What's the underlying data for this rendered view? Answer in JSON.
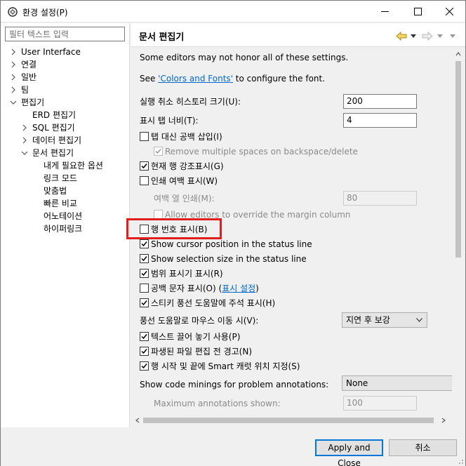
{
  "window": {
    "title": "환경 설정(P)"
  },
  "filter": {
    "placeholder": "필터 텍스트 입력"
  },
  "tree": [
    {
      "label": "User Interface"
    },
    {
      "label": "연결"
    },
    {
      "label": "일반"
    },
    {
      "label": "팀"
    },
    {
      "label": "편집기"
    },
    {
      "label": "ERD 편집기"
    },
    {
      "label": "SQL 편집기"
    },
    {
      "label": "데이터 편집기"
    },
    {
      "label": "문서 편집기"
    },
    {
      "label": "내게 필요한 옵션"
    },
    {
      "label": "링크 모드"
    },
    {
      "label": "맞춤법"
    },
    {
      "label": "빠른 비교"
    },
    {
      "label": "어노테이션"
    },
    {
      "label": "하이퍼링크"
    }
  ],
  "page": {
    "title": "문서 편집기",
    "note": "Some editors may not honor all of these settings.",
    "font_prefix": "See ",
    "font_link": "'Colors and Fonts'",
    "font_suffix": " to configure the font.",
    "undo_label": "실행 취소 히스토리 크기(U):",
    "undo_value": "200",
    "tab_label": "표시 탭 너비(T):",
    "tab_value": "4",
    "spaces_for_tabs": {
      "label": "탭 대신 공백 삽입(I)",
      "checked": false
    },
    "remove_multiple": {
      "label": "Remove multiple spaces on backspace/delete",
      "checked": true,
      "disabled": true
    },
    "highlight_line": {
      "label": "현재 행 강조표시(G)",
      "checked": true
    },
    "print_margin": {
      "label": "인쇄 여백 표시(W)",
      "checked": false
    },
    "margin_col_label": "여백 열 인쇄(M):",
    "margin_col_value": "80",
    "allow_override": {
      "label": "Allow editors to override the margin column",
      "checked": false,
      "disabled": true
    },
    "line_numbers": {
      "label": "행 번호 표시(B)",
      "checked": false
    },
    "cursor_pos": {
      "label": "Show cursor position in the status line",
      "checked": true
    },
    "selection_size": {
      "label": "Show selection size in the status line",
      "checked": true
    },
    "range_indicator": {
      "label": "범위 표시기 표시(R)",
      "checked": true
    },
    "whitespace": {
      "label": "공백 문자 표시(O) (",
      "link": "표시 설정",
      "suffix": ")",
      "checked": false
    },
    "sticky_help": {
      "label": "스티키 풍선 도움말에 주석 표시(H)",
      "checked": true
    },
    "hover_label": "풍선 도움말로 마우스 이동 시(V):",
    "hover_value": "지연 후 보강",
    "drag_drop": {
      "label": "텍스트 끌어 놓기 사용(P)",
      "checked": true
    },
    "warn_derived": {
      "label": "파생된 파일 편집 전 경고(N)",
      "checked": true
    },
    "smart_caret": {
      "label": "행 시작 및 끝에 Smart 캐럿 위치 지정(S)",
      "checked": true
    },
    "code_minings_label": "Show code minings for problem annotations:",
    "code_minings_value": "None",
    "max_annotations_label": "Maximum annotations shown:",
    "max_annotations_value": "100"
  },
  "buttons": {
    "apply_close": "Apply and Close",
    "cancel": "취소"
  }
}
